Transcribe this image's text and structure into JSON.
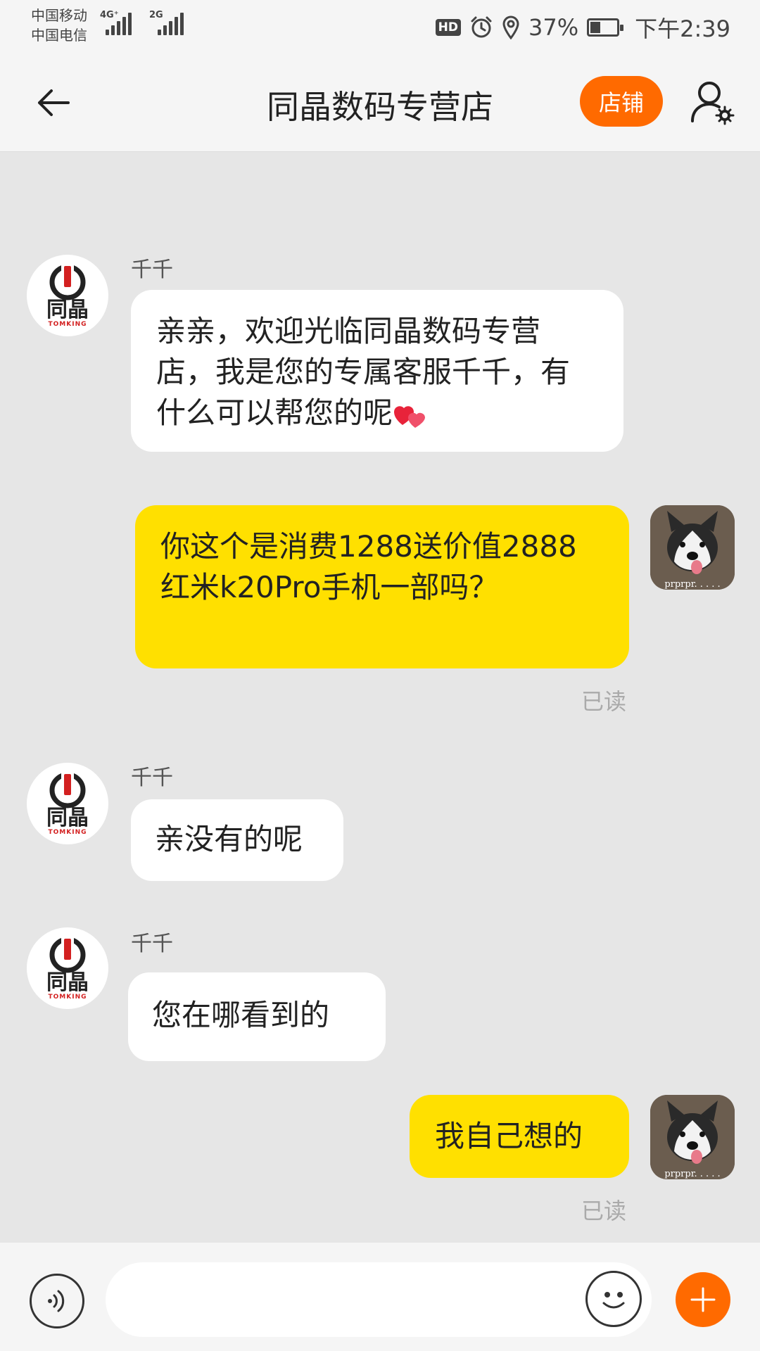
{
  "status_bar": {
    "carrier_1": "中国移动",
    "carrier_2": "中国电信",
    "network_1": "4G⁺",
    "network_2": "2G",
    "hd": "HD",
    "battery": "37%",
    "battery_level": 0.37,
    "time": "下午2:39"
  },
  "header": {
    "title": "同晶数码专营店",
    "shop_button": "店铺"
  },
  "shop_logo": {
    "text": "同晶",
    "sub": "TOMKING"
  },
  "messages": [
    {
      "sender": "千千",
      "text": "亲亲，欢迎光临同晶数码专营店，我是您的专属客服千千，有什么可以帮您的呢"
    },
    {
      "text": "你这个是消费1288送价值2888红米k20Pro手机一部吗？",
      "status": "已读",
      "avatar_caption": "prprpr. . . . ."
    },
    {
      "sender": "千千",
      "text": "亲没有的呢"
    },
    {
      "sender": "千千",
      "text": "您在哪看到的"
    },
    {
      "text": "我自己想的",
      "status": "已读",
      "avatar_caption": "prprpr. . . . ."
    }
  ],
  "colors": {
    "accent": "#ff6a00",
    "outgoing_bubble": "#ffe000",
    "incoming_bubble": "#ffffff",
    "chat_bg": "#e6e6e6"
  }
}
